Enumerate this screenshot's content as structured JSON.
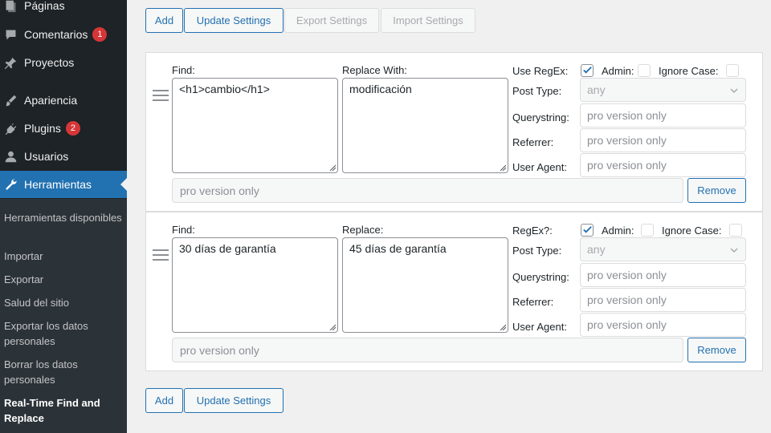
{
  "sidebar": {
    "items": [
      {
        "label": "Páginas",
        "icon": "pages-icon"
      },
      {
        "label": "Comentarios",
        "badge": "1",
        "icon": "comments-icon"
      },
      {
        "label": "Proyectos",
        "icon": "pin-icon"
      },
      {
        "label": "Apariencia",
        "icon": "brush-icon"
      },
      {
        "label": "Plugins",
        "badge": "2",
        "icon": "plug-icon"
      },
      {
        "label": "Usuarios",
        "icon": "user-icon"
      },
      {
        "label": "Herramientas",
        "icon": "wrench-icon",
        "current": true
      }
    ],
    "submenu": [
      "Herramientas disponibles",
      "Importar",
      "Exportar",
      "Salud del sitio",
      "Exportar los datos personales",
      "Borrar los datos personales",
      "Real-Time Find and Replace"
    ]
  },
  "toolbar": {
    "add": "Add",
    "update": "Update Settings",
    "export": "Export Settings",
    "import": "Import Settings"
  },
  "rules": [
    {
      "find_label": "Find:",
      "replace_label": "Replace With:",
      "regex_label": "Use RegEx:",
      "regex_checked": true,
      "admin_label": "Admin:",
      "admin_checked": false,
      "ignore_case_label": "Ignore Case:",
      "ignore_case_checked": false,
      "find_value": "<h1>cambio</h1>",
      "replace_value": "modificación",
      "post_type_label": "Post Type:",
      "post_type_value": "any",
      "querystring_label": "Querystring:",
      "querystring_placeholder": "pro version only",
      "referrer_label": "Referrer:",
      "referrer_placeholder": "pro version only",
      "user_agent_label": "User Agent:",
      "user_agent_placeholder": "pro version only",
      "extra_placeholder": "pro version only",
      "remove": "Remove"
    },
    {
      "find_label": "Find:",
      "replace_label": "Replace:",
      "regex_label": "RegEx?:",
      "regex_checked": true,
      "admin_label": "Admin:",
      "admin_checked": false,
      "ignore_case_label": "Ignore Case:",
      "ignore_case_checked": false,
      "find_value": "30 días de garantía",
      "replace_value": "45 días de garantía",
      "post_type_label": "Post Type:",
      "post_type_value": "any",
      "querystring_label": "Querystring:",
      "querystring_placeholder": "pro version only",
      "referrer_label": "Referrer:",
      "referrer_placeholder": "pro version only",
      "user_agent_label": "User Agent:",
      "user_agent_placeholder": "pro version only",
      "extra_placeholder": "pro version only",
      "remove": "Remove"
    }
  ],
  "bottom_toolbar": {
    "add": "Add",
    "update": "Update Settings"
  },
  "colors": {
    "sidebar_bg": "#1d2327",
    "accent": "#2271b1",
    "badge": "#d63638"
  }
}
